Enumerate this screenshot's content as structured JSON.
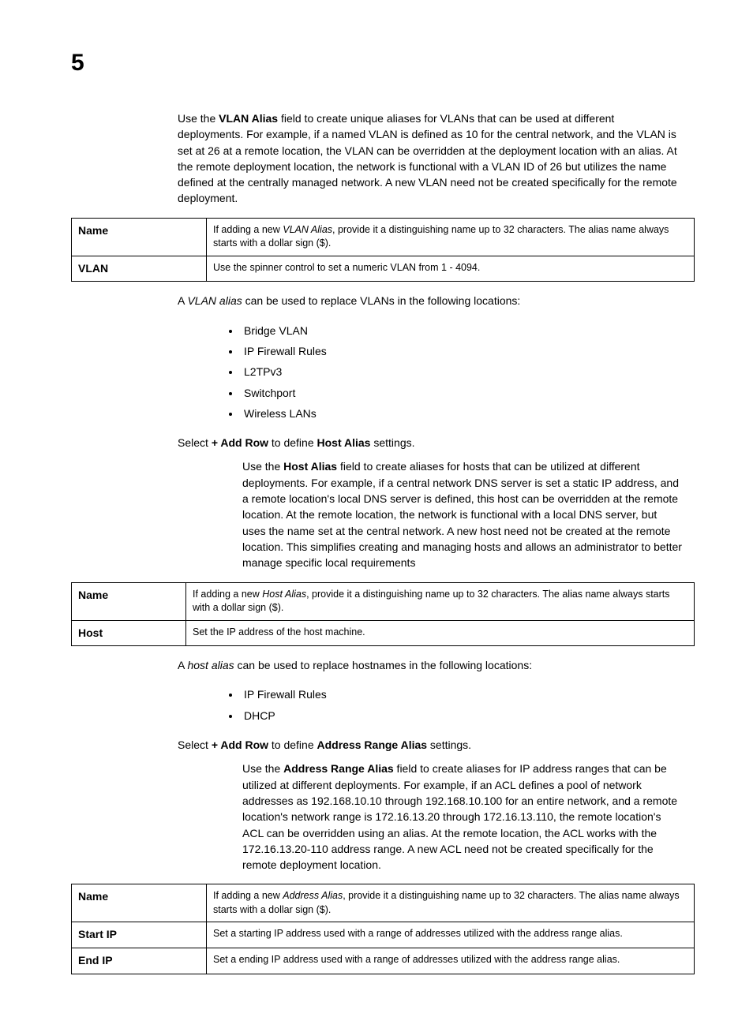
{
  "chapter": "5",
  "p_vlan_intro_pre": "Use the ",
  "p_vlan_intro_bold": "VLAN Alias",
  "p_vlan_intro_post": " field to create unique aliases for VLANs that can be used at different deployments. For example, if a named VLAN is defined as 10 for the central network, and the VLAN is set at 26 at a remote location, the VLAN can be overridden at the deployment location with an alias. At the remote deployment location, the network is functional with a VLAN ID of 26 but utilizes the name defined at the centrally managed network. A new VLAN need not be created specifically for the remote deployment.",
  "table_vlan": {
    "r1_label": "Name",
    "r1_desc_pre": "If adding a new ",
    "r1_desc_ital": "VLAN Alias",
    "r1_desc_post": ", provide it a distinguishing name up to 32 characters. The alias name always starts with a dollar sign ($).",
    "r2_label": "VLAN",
    "r2_desc": "Use the spinner control to set a numeric VLAN from 1 - 4094."
  },
  "p_vlan_loc_pre": "A ",
  "p_vlan_loc_ital": "VLAN alias",
  "p_vlan_loc_post": " can be used to replace VLANs in the following locations:",
  "list_vlan": [
    "Bridge VLAN",
    "IP Firewall Rules",
    "L2TPv3",
    "Switchport",
    "Wireless LANs"
  ],
  "sel_host_pre": "Select ",
  "sel_host_b1": "+ Add Row",
  "sel_host_mid": " to define ",
  "sel_host_b2": "Host Alias",
  "sel_host_post": " settings.",
  "p_host_intro_pre": "Use the ",
  "p_host_intro_bold": "Host Alias",
  "p_host_intro_post": " field to create aliases for hosts that can be utilized at different deployments. For example, if a central network DNS server is set a static IP address, and a remote location's local DNS server is defined, this host can be overridden at the remote location. At the remote location, the network is functional with a local DNS server, but uses the name set at the central network. A new host need not be created at the remote location. This simplifies creating and managing hosts and allows an administrator to better manage specific local requirements",
  "table_host": {
    "r1_label": "Name",
    "r1_desc_pre": "If adding a new ",
    "r1_desc_ital": "Host Alias",
    "r1_desc_post": ", provide it a distinguishing name up to 32 characters. The alias name always starts with a dollar sign ($).",
    "r2_label": "Host",
    "r2_desc": "Set the IP address of the host machine."
  },
  "p_host_loc_pre": "A ",
  "p_host_loc_ital": "host alias",
  "p_host_loc_post": " can be used to replace hostnames in the following locations:",
  "list_host": [
    "IP Firewall Rules",
    "DHCP"
  ],
  "sel_addr_pre": "Select ",
  "sel_addr_b1": "+ Add Row",
  "sel_addr_mid": " to define ",
  "sel_addr_b2": "Address Range Alias",
  "sel_addr_post": " settings.",
  "p_addr_intro_pre": "Use the ",
  "p_addr_intro_bold": "Address Range Alias",
  "p_addr_intro_post": " field to create aliases for IP address ranges that can be utilized at different deployments. For example, if an ACL defines a pool of network addresses as 192.168.10.10 through 192.168.10.100 for an entire network, and a remote location's network range is 172.16.13.20 through 172.16.13.110, the remote location's ACL can be overridden using an alias. At the remote location, the ACL works with the 172.16.13.20-110 address range. A new ACL need not be created specifically for the remote deployment location.",
  "table_addr": {
    "r1_label": "Name",
    "r1_desc_pre": "If adding a new ",
    "r1_desc_ital": "Address Alias",
    "r1_desc_post": ", provide it a distinguishing name up to 32 characters. The alias name always starts with a dollar sign ($).",
    "r2_label": "Start IP",
    "r2_desc": "Set a starting IP address used with a range of addresses utilized with the address range alias.",
    "r3_label": "End IP",
    "r3_desc": "Set a ending IP address used with a range of addresses utilized with the address range alias."
  }
}
